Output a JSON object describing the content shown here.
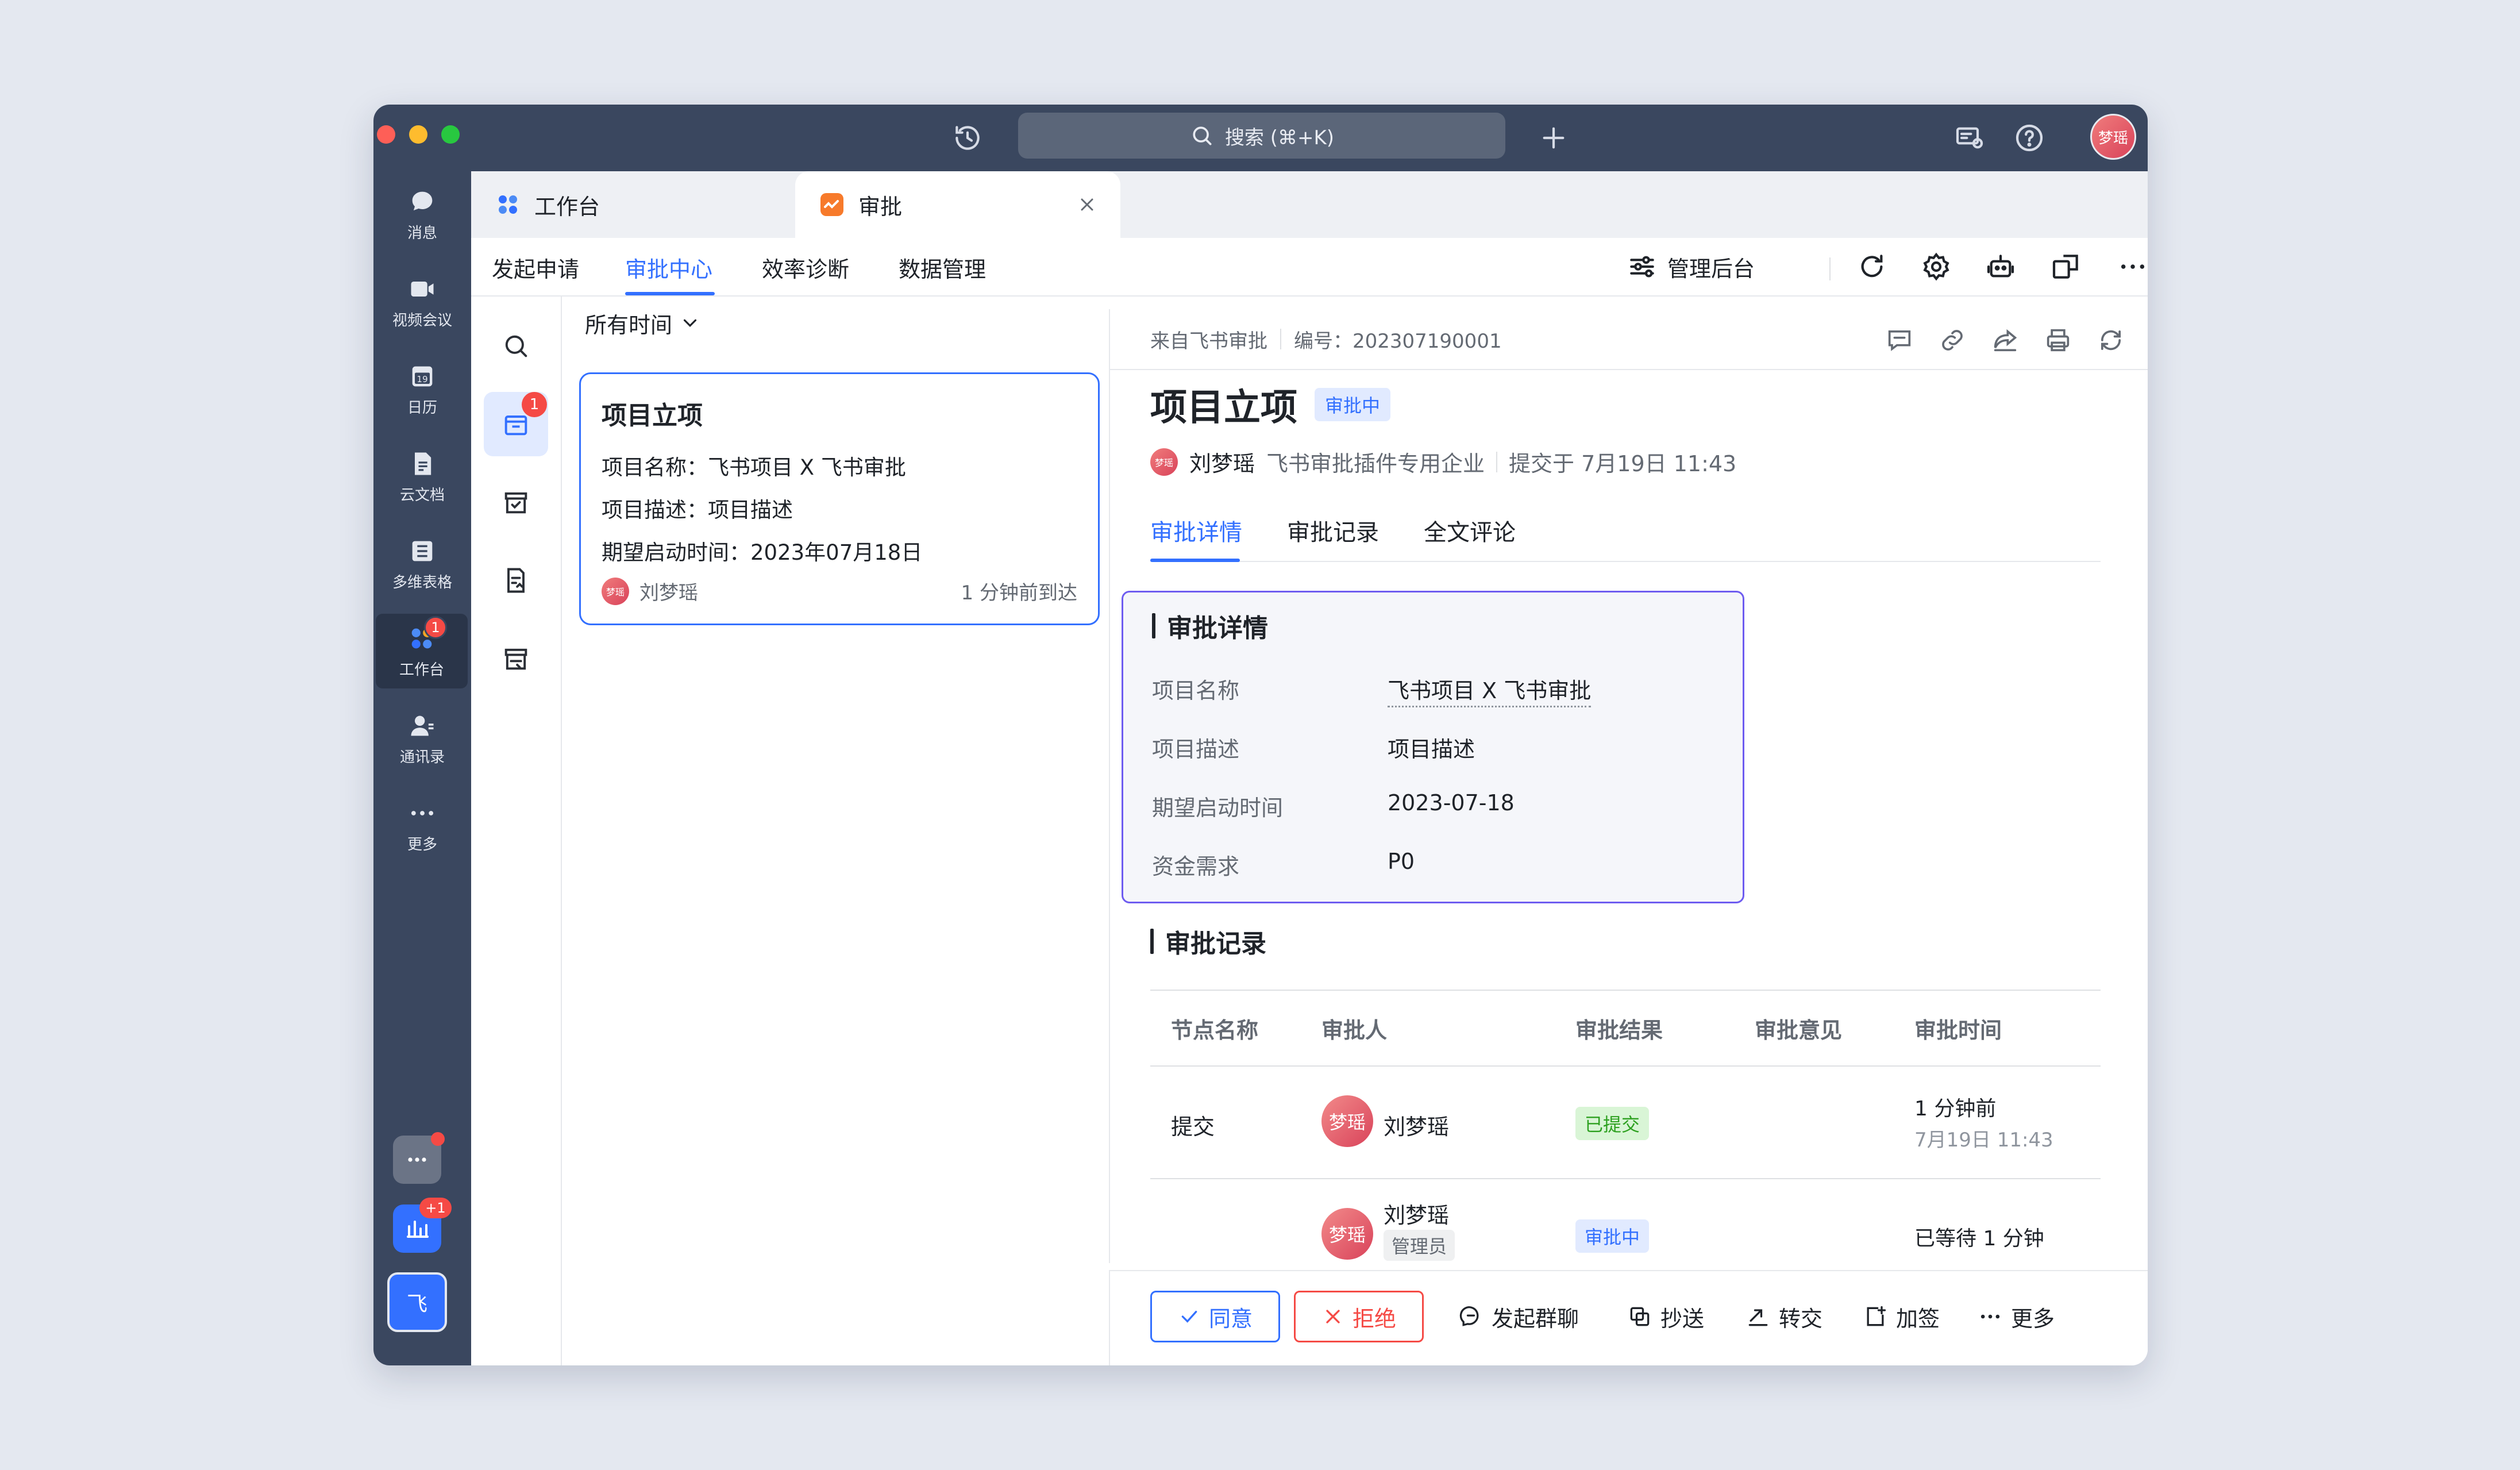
{
  "titlebar": {
    "search_placeholder": "搜索 (⌘+K)",
    "avatar_text": "梦瑶"
  },
  "sidebar": {
    "items": [
      {
        "label": "消息",
        "icon": "chat-bubble-icon"
      },
      {
        "label": "视频会议",
        "icon": "video-camera-icon"
      },
      {
        "label": "日历",
        "icon": "calendar-icon",
        "day": "19"
      },
      {
        "label": "云文档",
        "icon": "document-icon"
      },
      {
        "label": "多维表格",
        "icon": "table-icon"
      },
      {
        "label": "工作台",
        "icon": "workspace-icon",
        "badge": "1"
      },
      {
        "label": "通讯录",
        "icon": "contacts-icon"
      },
      {
        "label": "更多",
        "icon": "more-dots-icon"
      }
    ],
    "bottom_badge": "+1",
    "feishu_logo": "飞"
  },
  "app_tabs": [
    {
      "label": "工作台"
    },
    {
      "label": "审批"
    }
  ],
  "subnav": {
    "tabs": [
      "发起申请",
      "审批中心",
      "效率诊断",
      "数据管理"
    ],
    "active": "审批中心",
    "admin_label": "管理后台"
  },
  "iconcol": {
    "badge": "1"
  },
  "list": {
    "filter_label": "所有时间",
    "card": {
      "title": "项目立项",
      "rows": [
        {
          "k": "项目名称：",
          "v": "飞书项目 X 飞书审批"
        },
        {
          "k": "项目描述：",
          "v": "项目描述"
        },
        {
          "k": "期望启动时间：",
          "v": "2023年07月18日"
        }
      ],
      "user": "刘梦瑶",
      "avatar_text": "梦瑶",
      "time": "1 分钟前到达"
    }
  },
  "detail": {
    "source": "来自飞书审批",
    "number": "编号：202307190001",
    "title": "项目立项",
    "status": "审批中",
    "avatar_text": "梦瑶",
    "applicant": "刘梦瑶",
    "company": "飞书审批插件专用企业",
    "submitted": "提交于 7月19日 11:43",
    "tabs": [
      "审批详情",
      "审批记录",
      "全文评论"
    ],
    "form": {
      "section": "审批详情",
      "fields": [
        {
          "k": "项目名称",
          "v": "飞书项目 X 飞书审批"
        },
        {
          "k": "项目描述",
          "v": "项目描述"
        },
        {
          "k": "期望启动时间",
          "v": "2023-07-18"
        },
        {
          "k": "资金需求",
          "v": "P0"
        }
      ]
    },
    "records": {
      "section": "审批记录",
      "headers": [
        "节点名称",
        "审批人",
        "审批结果",
        "审批意见",
        "审批时间"
      ],
      "rows": [
        {
          "node": "提交",
          "avatar": "梦瑶",
          "approver": "刘梦瑶",
          "result": "已提交",
          "time": "1 分钟前",
          "time_sub": "7月19日 11:43"
        },
        {
          "node": "",
          "avatar": "梦瑶",
          "approver": "刘梦瑶",
          "role": "管理员",
          "result": "审批中",
          "time": "已等待 1 分钟"
        }
      ]
    }
  },
  "actions": {
    "agree": "同意",
    "reject": "拒绝",
    "group_chat": "发起群聊",
    "cc": "抄送",
    "transfer": "转交",
    "add_sign": "加签",
    "more": "更多"
  },
  "colors": {
    "accent": "#3370ff",
    "danger": "#f54a45",
    "sidebar": "#3a475f",
    "success": "#2ea121"
  }
}
